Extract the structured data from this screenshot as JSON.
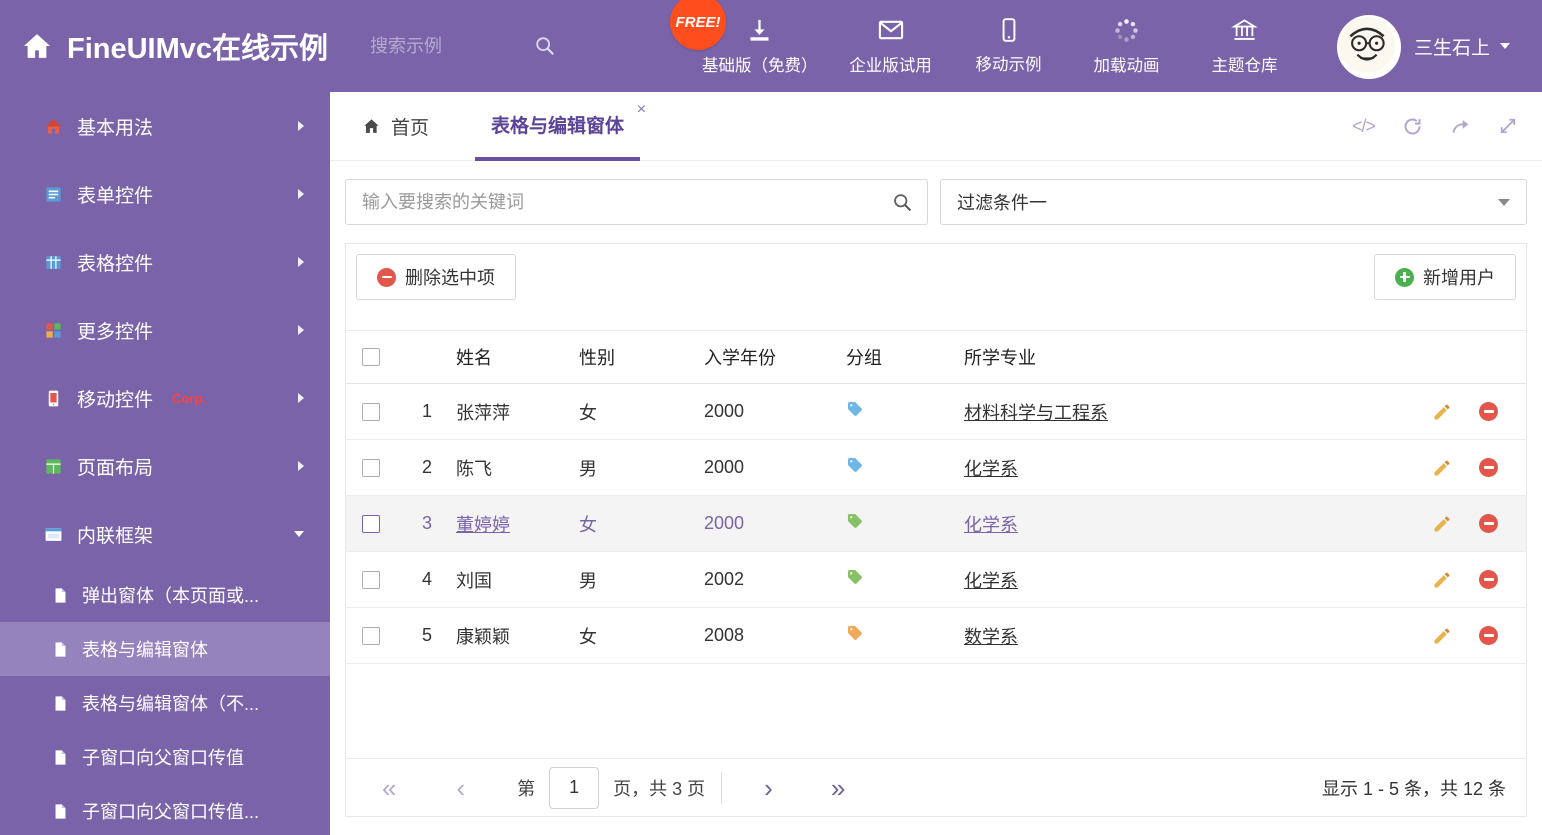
{
  "header": {
    "title": "FineUIMvc在线示例",
    "search_placeholder": "搜索示例",
    "free_badge": "FREE!",
    "nav": [
      {
        "label": "基础版（免费）",
        "icon": "download-icon"
      },
      {
        "label": "企业版试用",
        "icon": "envelope-icon"
      },
      {
        "label": "移动示例",
        "icon": "mobile-icon"
      },
      {
        "label": "加载动画",
        "icon": "spinner-icon"
      },
      {
        "label": "主题仓库",
        "icon": "bank-icon"
      }
    ],
    "username": "三生石上"
  },
  "sidebar": {
    "items": [
      {
        "label": "基本用法",
        "icon": "home-icon"
      },
      {
        "label": "表单控件",
        "icon": "form-icon"
      },
      {
        "label": "表格控件",
        "icon": "table-icon"
      },
      {
        "label": "更多控件",
        "icon": "widgets-icon"
      },
      {
        "label": "移动控件",
        "badge": "Corp.",
        "icon": "mobile-icon"
      },
      {
        "label": "页面布局",
        "icon": "layout-icon"
      },
      {
        "label": "内联框架",
        "icon": "frame-icon",
        "expanded": true
      }
    ],
    "subitems": [
      {
        "label": "弹出窗体（本页面或..."
      },
      {
        "label": "表格与编辑窗体",
        "selected": true
      },
      {
        "label": "表格与编辑窗体（不..."
      },
      {
        "label": "子窗口向父窗口传值"
      },
      {
        "label": "子窗口向父窗口传值..."
      }
    ]
  },
  "tabs": {
    "home_label": "首页",
    "active_label": "表格与编辑窗体",
    "close_icon": "×",
    "code_icon": "</>"
  },
  "filters": {
    "search_placeholder": "输入要搜索的关键词",
    "dropdown_value": "过滤条件一"
  },
  "toolbar": {
    "delete_label": "删除选中项",
    "add_label": "新增用户"
  },
  "table": {
    "columns": {
      "name": "姓名",
      "gender": "性别",
      "year": "入学年份",
      "group": "分组",
      "major": "所学专业"
    },
    "rows": [
      {
        "index": "1",
        "name": "张萍萍",
        "gender": "女",
        "year": "2000",
        "tag_color": "#6fb7e9",
        "major": "材料科学与工程系"
      },
      {
        "index": "2",
        "name": "陈飞",
        "gender": "男",
        "year": "2000",
        "tag_color": "#6fb7e9",
        "major": "化学系"
      },
      {
        "index": "3",
        "name": "董婷婷",
        "gender": "女",
        "year": "2000",
        "tag_color": "#86c166",
        "major": "化学系",
        "highlighted": true
      },
      {
        "index": "4",
        "name": "刘国",
        "gender": "男",
        "year": "2002",
        "tag_color": "#86c166",
        "major": "化学系"
      },
      {
        "index": "5",
        "name": "康颖颖",
        "gender": "女",
        "year": "2008",
        "tag_color": "#f0a95a",
        "major": "数学系"
      }
    ]
  },
  "pagination": {
    "first_icon": "«",
    "prev_icon": "‹",
    "next_icon": "›",
    "last_icon": "»",
    "page_prefix": "第",
    "current_page": "1",
    "page_suffix": "页，共 3 页",
    "summary": "显示 1 - 5 条，共 12 条"
  },
  "colors": {
    "purple": "#7a63a8",
    "purple_light": "#9583bd",
    "tab_active": "#5b4397",
    "free_badge": "#ff4e1e",
    "danger": "#e2574c",
    "success": "#4caf50",
    "corp_red": "#ff4040"
  }
}
